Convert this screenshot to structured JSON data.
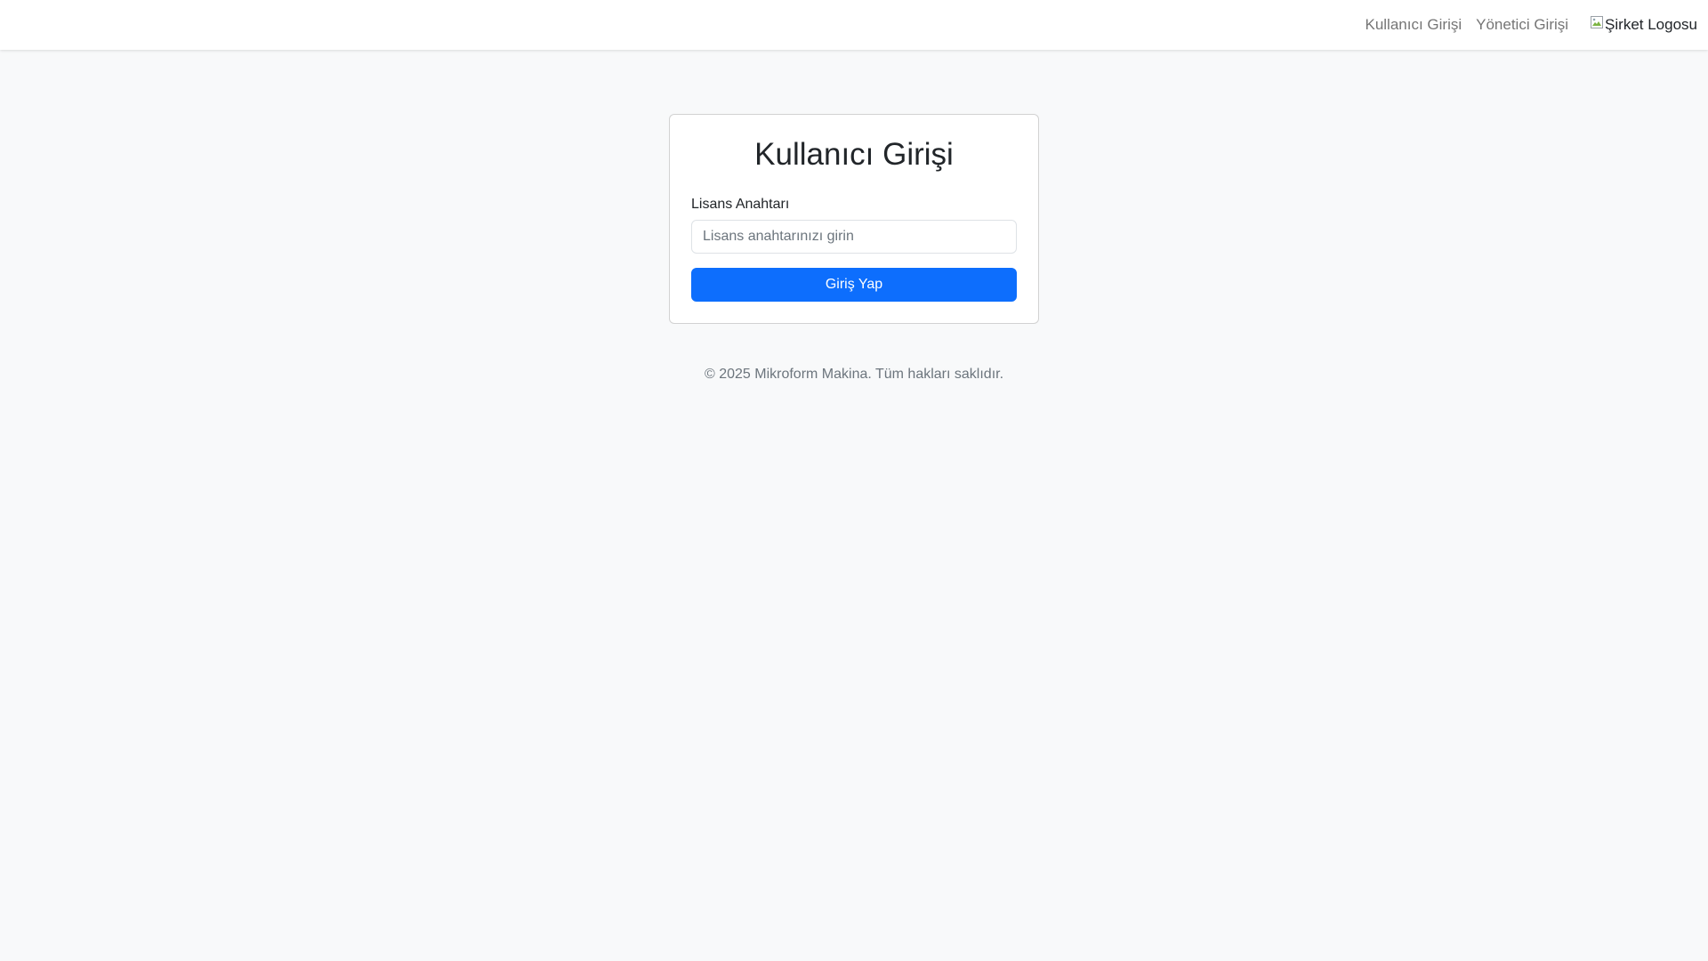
{
  "navbar": {
    "links": [
      {
        "label": "Kullanıcı Girişi"
      },
      {
        "label": "Yönetici Girişi"
      }
    ],
    "logo_alt": "Şirket Logosu",
    "logo_icon": "broken-image-icon"
  },
  "login": {
    "title": "Kullanıcı Girişi",
    "license_label": "Lisans Anahtarı",
    "license_value": "",
    "license_placeholder": "Lisans anahtarınızı girin",
    "submit_label": "Giriş Yap"
  },
  "footer": {
    "text": "© 2025 Mikroform Makina. Tüm hakları saklıdır."
  },
  "colors": {
    "primary": "#0d6efd",
    "background": "#f8f9fa",
    "muted_text": "#6c757d"
  }
}
